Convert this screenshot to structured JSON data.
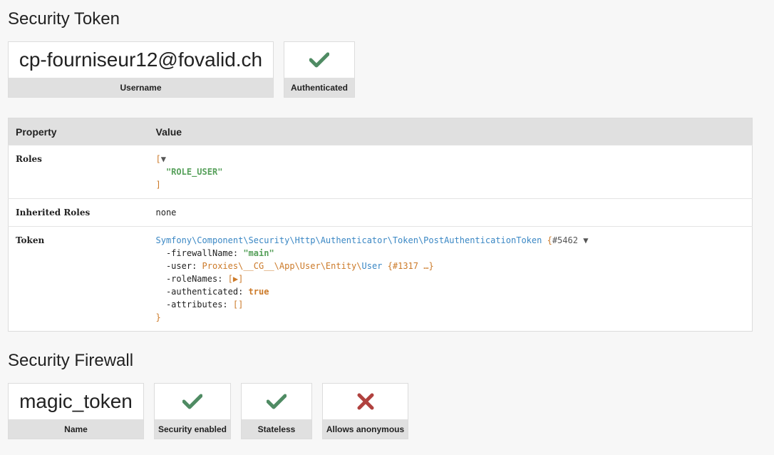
{
  "token_section": {
    "title": "Security Token",
    "username": {
      "value": "cp-fourniseur12@fovalid.ch",
      "label": "Username"
    },
    "authenticated": {
      "icon": "check-icon",
      "label": "Authenticated",
      "color": "#4f8b63"
    }
  },
  "table": {
    "headers": [
      "Property",
      "Value"
    ],
    "roles": {
      "key": "Roles",
      "open": "[",
      "toggle": "▼",
      "items": [
        "\"ROLE_USER\""
      ],
      "close": "]"
    },
    "inherited_roles": {
      "key": "Inherited Roles",
      "value": "none"
    },
    "token": {
      "key": "Token",
      "class_path": "Symfony\\Component\\Security\\Http\\Authenticator\\Token\\PostAuthenticationToken",
      "open_brace": "{",
      "ref": "#5462",
      "toggle": "▼",
      "fields": {
        "firewall_name_key": "-firewallName: ",
        "firewall_name_value": "\"main\"",
        "user_key": "-user: ",
        "user_ns": "Proxies\\__CG__\\App\\User\\Entity\\",
        "user_class": "User",
        "user_ref": "{#1317 …}",
        "role_names_key": "-roleNames: ",
        "role_names_value": "[▶]",
        "authenticated_key": "-authenticated: ",
        "authenticated_value": "true",
        "attributes_key": "-attributes: ",
        "attributes_value": "[]"
      },
      "close_brace": "}"
    }
  },
  "firewall_section": {
    "title": "Security Firewall",
    "name": {
      "value": "magic_token",
      "label": "Name"
    },
    "security_enabled": {
      "icon": "check-icon",
      "label": "Security enabled",
      "color": "#4f8b63"
    },
    "stateless": {
      "icon": "check-icon",
      "label": "Stateless",
      "color": "#4f8b63"
    },
    "allows_anonymous": {
      "icon": "cross-icon",
      "label": "Allows anonymous",
      "color": "#b0413e"
    }
  }
}
